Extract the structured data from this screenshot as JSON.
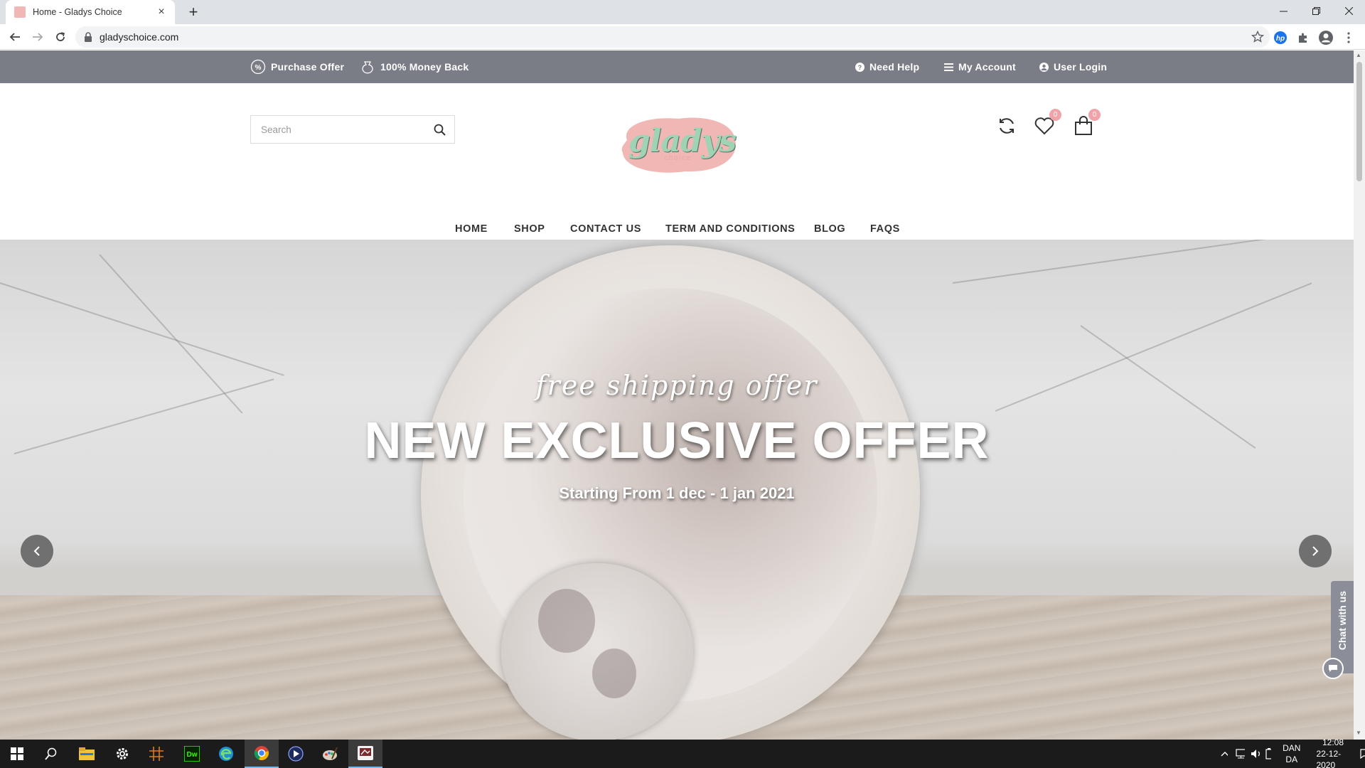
{
  "browser": {
    "tab_title": "Home - Gladys Choice",
    "new_tab": "+",
    "url": "gladyschoice.com"
  },
  "topbar": {
    "purchase_offer": "Purchase Offer",
    "money_back": "100% Money Back",
    "need_help": "Need Help",
    "my_account": "My Account",
    "user_login": "User Login"
  },
  "header": {
    "search_placeholder": "Search",
    "logo_text": "gladys",
    "logo_sub": "choice",
    "wishlist_count": "0",
    "cart_count": "0"
  },
  "nav": {
    "items": [
      "HOME",
      "SHOP",
      "CONTACT US",
      "TERM AND CONDITIONS",
      "BLOG",
      "FAQS"
    ]
  },
  "hero": {
    "script": "free shipping offer",
    "title": "NEW EXCLUSIVE OFFER",
    "subtitle": "Starting From 1 dec - 1 jan 2021"
  },
  "chat": {
    "label": "Chat with us"
  },
  "taskbar": {
    "lang_top": "DAN",
    "lang_bottom": "DA",
    "time": "12:08",
    "date": "22-12-2020"
  },
  "colors": {
    "topbar": "#7a7c86",
    "badge": "#f0a3a8",
    "logo_green": "#9ed4b4",
    "logo_pink": "#f0b7b4"
  }
}
